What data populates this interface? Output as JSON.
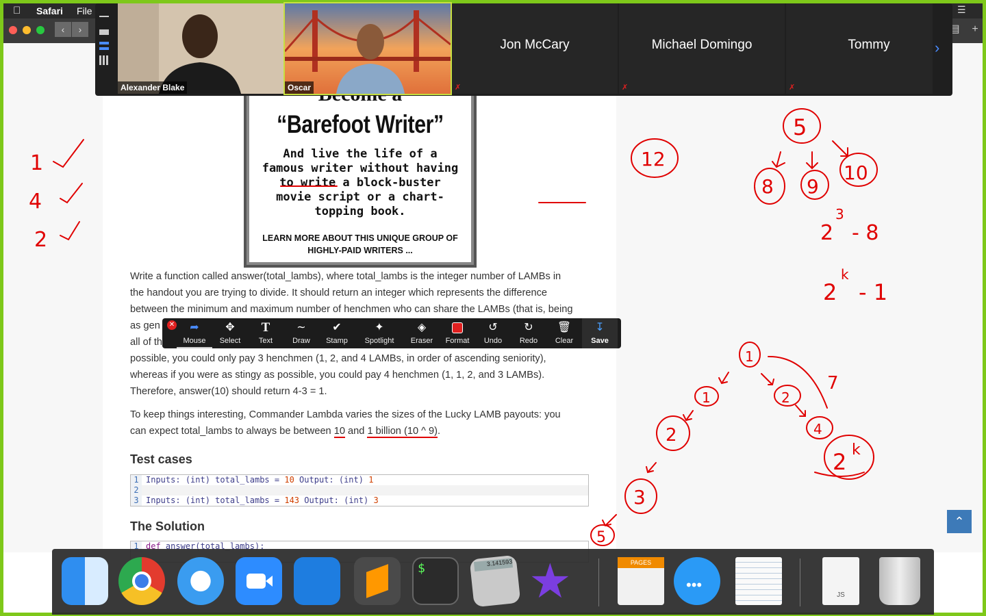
{
  "menubar": {
    "app": "Safari",
    "file_menu": "File"
  },
  "zoom": {
    "participants": [
      {
        "name": "Alexander Blake",
        "video": true
      },
      {
        "name": "Oscar",
        "video": true
      },
      {
        "name": "Jon McCary",
        "video": false
      },
      {
        "name": "Michael Domingo",
        "video": false
      },
      {
        "name": "Tommy",
        "video": false
      }
    ],
    "next_icon": "chevron-right-icon"
  },
  "ad": {
    "become": "Become a",
    "title": "“Barefoot Writer”",
    "body": "And live the life of a famous writer without having to write a block-buster movie script or a chart-topping book.",
    "foot": "LEARN MORE ABOUT THIS UNIQUE GROUP OF HIGHLY-PAID WRITERS ..."
  },
  "article": {
    "para1_line1": "Write a function called answer(total_lambs), where total_lambs is the integer number of LAMBs in",
    "para1_line2": "the handout you are trying to divide. It should return an integer which represents the difference",
    "para1_line3": "between the minimum and maximum number of henchmen who can share the LAMBs (that is, being",
    "para1_line4": "as gen",
    "para1_line5": "all of th",
    "para1_line6": "possible, you could only pay 3 henchmen (1, 2, and 4 LAMBs, in order of ascending seniority),",
    "para1_line7": "whereas if you were as stingy as possible, you could pay 4 henchmen (1, 1, 2, and 3 LAMBs).",
    "para1_line8": "Therefore, answer(10) should return 4-3 = 1.",
    "para2_line1": "To keep things interesting, Commander Lambda varies the sizes of the Lucky LAMB payouts: you",
    "para2_pre": "can expect total_lambs to always be between ",
    "para2_u1": "10",
    "para2_mid": " and ",
    "para2_u2": "1 billion (10 ^ 9)",
    "para2_end": ".",
    "test_heading": "Test cases",
    "tests": [
      {
        "n": "1",
        "inputs": "Inputs:",
        "type1": "(int)",
        "arg": "total_lambs",
        "eq": "=",
        "val": "10",
        "outputs": "Output:",
        "type2": "(int)",
        "result": "1"
      },
      {
        "n": "2"
      },
      {
        "n": "3",
        "inputs": "Inputs:",
        "type1": "(int)",
        "arg": "total_lambs",
        "eq": "=",
        "val": "143",
        "outputs": "Output:",
        "type2": "(int)",
        "result": "3"
      }
    ],
    "solution_heading": "The Solution",
    "solution_line_no": "1",
    "solution_kw": "def",
    "solution_fn": "answer",
    "solution_rest": "(total_lambs):"
  },
  "annotation_toolbar": {
    "tools": [
      {
        "label": "Mouse",
        "icon": "cursor-arrow-icon"
      },
      {
        "label": "Select",
        "icon": "move-arrows-icon"
      },
      {
        "label": "Text",
        "icon": "text-T-icon"
      },
      {
        "label": "Draw",
        "icon": "squiggle-icon"
      },
      {
        "label": "Stamp",
        "icon": "checkmark-icon"
      },
      {
        "label": "Spotlight",
        "icon": "magic-wand-icon"
      },
      {
        "label": "Eraser",
        "icon": "eraser-icon"
      },
      {
        "label": "Format",
        "icon": "red-square-icon"
      },
      {
        "label": "Undo",
        "icon": "undo-icon"
      },
      {
        "label": "Redo",
        "icon": "redo-icon"
      },
      {
        "label": "Clear",
        "icon": "trash-icon"
      },
      {
        "label": "Save",
        "icon": "save-download-icon"
      }
    ],
    "accent": "#e02020"
  },
  "ink": {
    "left_checklist": [
      "1",
      "4",
      "2"
    ],
    "circled_top": [
      "5",
      "12",
      "8",
      "9",
      "10"
    ],
    "formula1_base": "2",
    "formula1_exp": "3",
    "formula1_rest": "- 8",
    "formula2_base": "2",
    "formula2_exp": "k",
    "formula2_rest": "- 1",
    "tree_nodes": [
      "1",
      "1",
      "2",
      "2",
      "4",
      "3",
      "5"
    ],
    "tree_side": "7",
    "tree_leaf_base": "2",
    "tree_leaf_exp": "k",
    "color": "#e00000"
  },
  "dock": {
    "apps": [
      "Finder",
      "Google Chrome",
      "Safari",
      "Zoom",
      "Xcode",
      "Sublime Text",
      "Terminal",
      "Calculator",
      "iMovie",
      "Pages",
      "Messages",
      "TextEdit",
      "JS",
      "Trash"
    ],
    "calculator_display": "3.141593",
    "pages_label": "PAGES",
    "js_label": "JS"
  }
}
